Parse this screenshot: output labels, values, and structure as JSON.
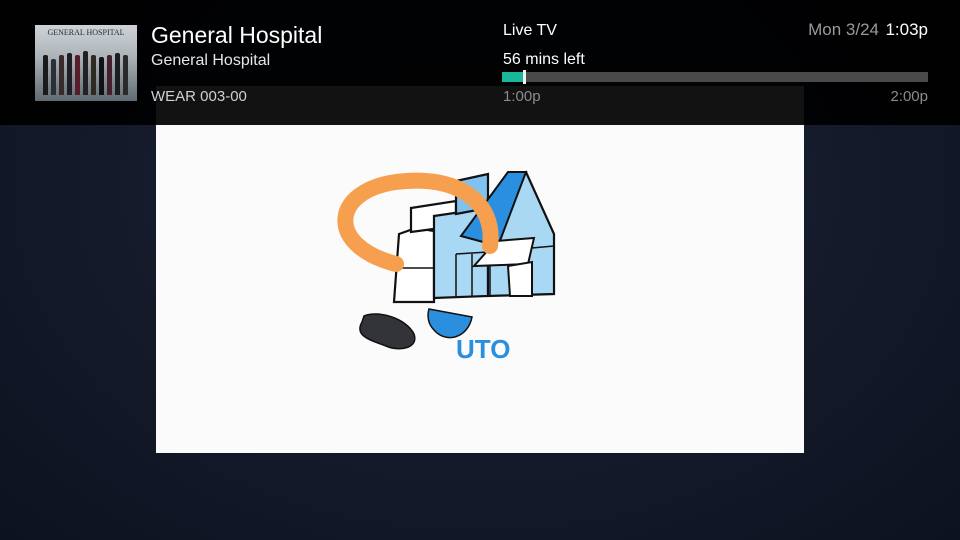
{
  "program": {
    "title": "General Hospital",
    "episode_title": "General Hospital",
    "channel": "WEAR 003-00",
    "thumbnail_text": "GENERAL HOSPITAL"
  },
  "status": {
    "mode": "Live TV",
    "time_left": "56 mins left",
    "progress_fraction": 0.05,
    "start_time": "1:00p",
    "end_time": "2:00p"
  },
  "clock": {
    "date": "Mon 3/24",
    "time": "1:03p"
  },
  "video_logo_text": "UTO",
  "colors": {
    "progress_fill": "#19b89a",
    "progress_track": "#4a4a4a",
    "logo_orange": "#f6a04f",
    "logo_blue": "#2b8fe0"
  }
}
